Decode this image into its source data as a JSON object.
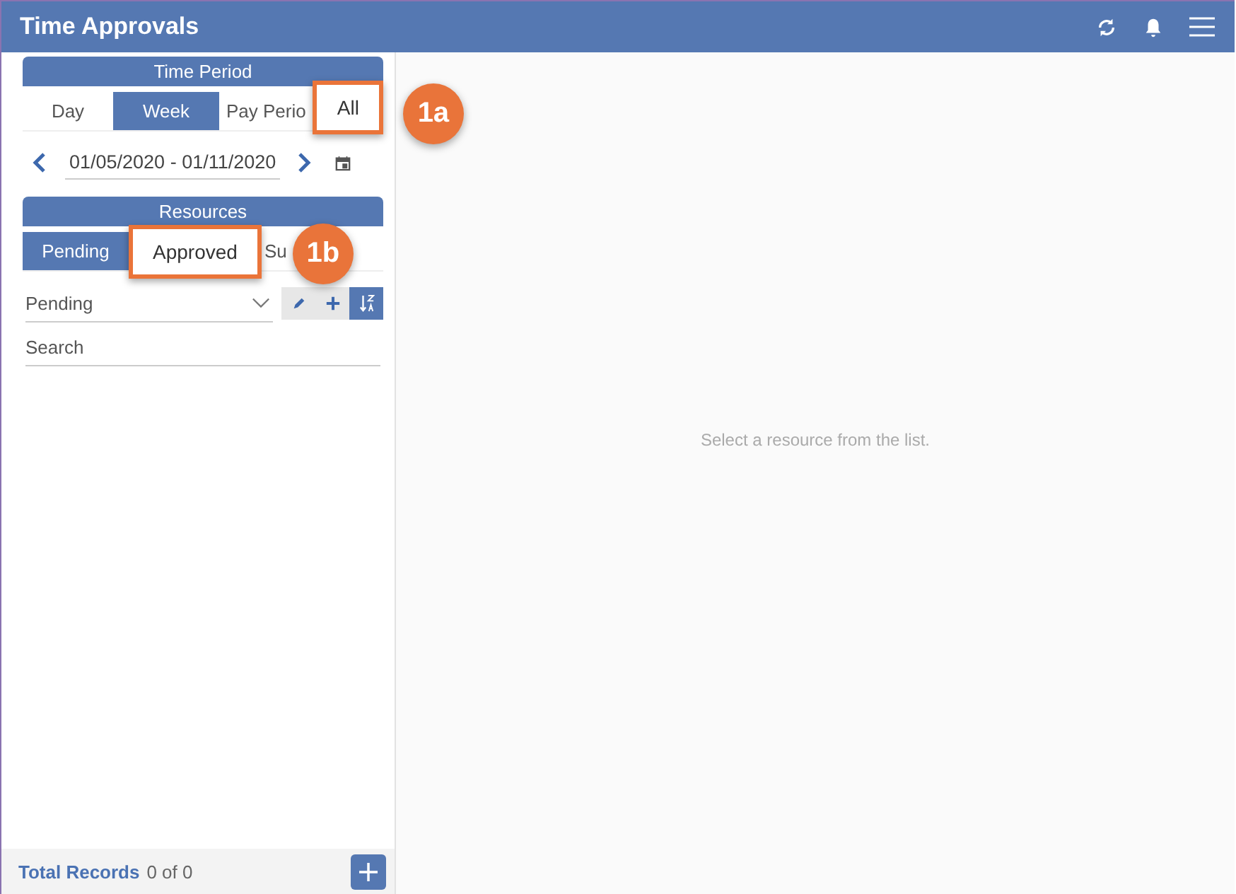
{
  "header": {
    "title": "Time Approvals"
  },
  "time_period": {
    "title": "Time Period",
    "tabs": [
      {
        "label": "Day",
        "selected": false,
        "highlighted": false
      },
      {
        "label": "Week",
        "selected": true,
        "highlighted": false
      },
      {
        "label": "Pay Perio",
        "selected": false,
        "highlighted": false
      },
      {
        "label": "All",
        "selected": false,
        "highlighted": true,
        "callout": "1a"
      }
    ],
    "date_range": "01/05/2020 - 01/11/2020"
  },
  "resources": {
    "title": "Resources",
    "tabs": [
      {
        "label": "Pending",
        "selected": true,
        "highlighted": false
      },
      {
        "label": "Approved",
        "selected": false,
        "highlighted": true,
        "callout": "1b"
      },
      {
        "label": "Su",
        "selected": false,
        "highlighted": false
      }
    ],
    "filter": {
      "value": "Pending"
    },
    "search": {
      "placeholder": "Search"
    }
  },
  "footer": {
    "label": "Total Records",
    "count": "0 of 0"
  },
  "detail": {
    "empty_message": "Select a resource from the list."
  }
}
